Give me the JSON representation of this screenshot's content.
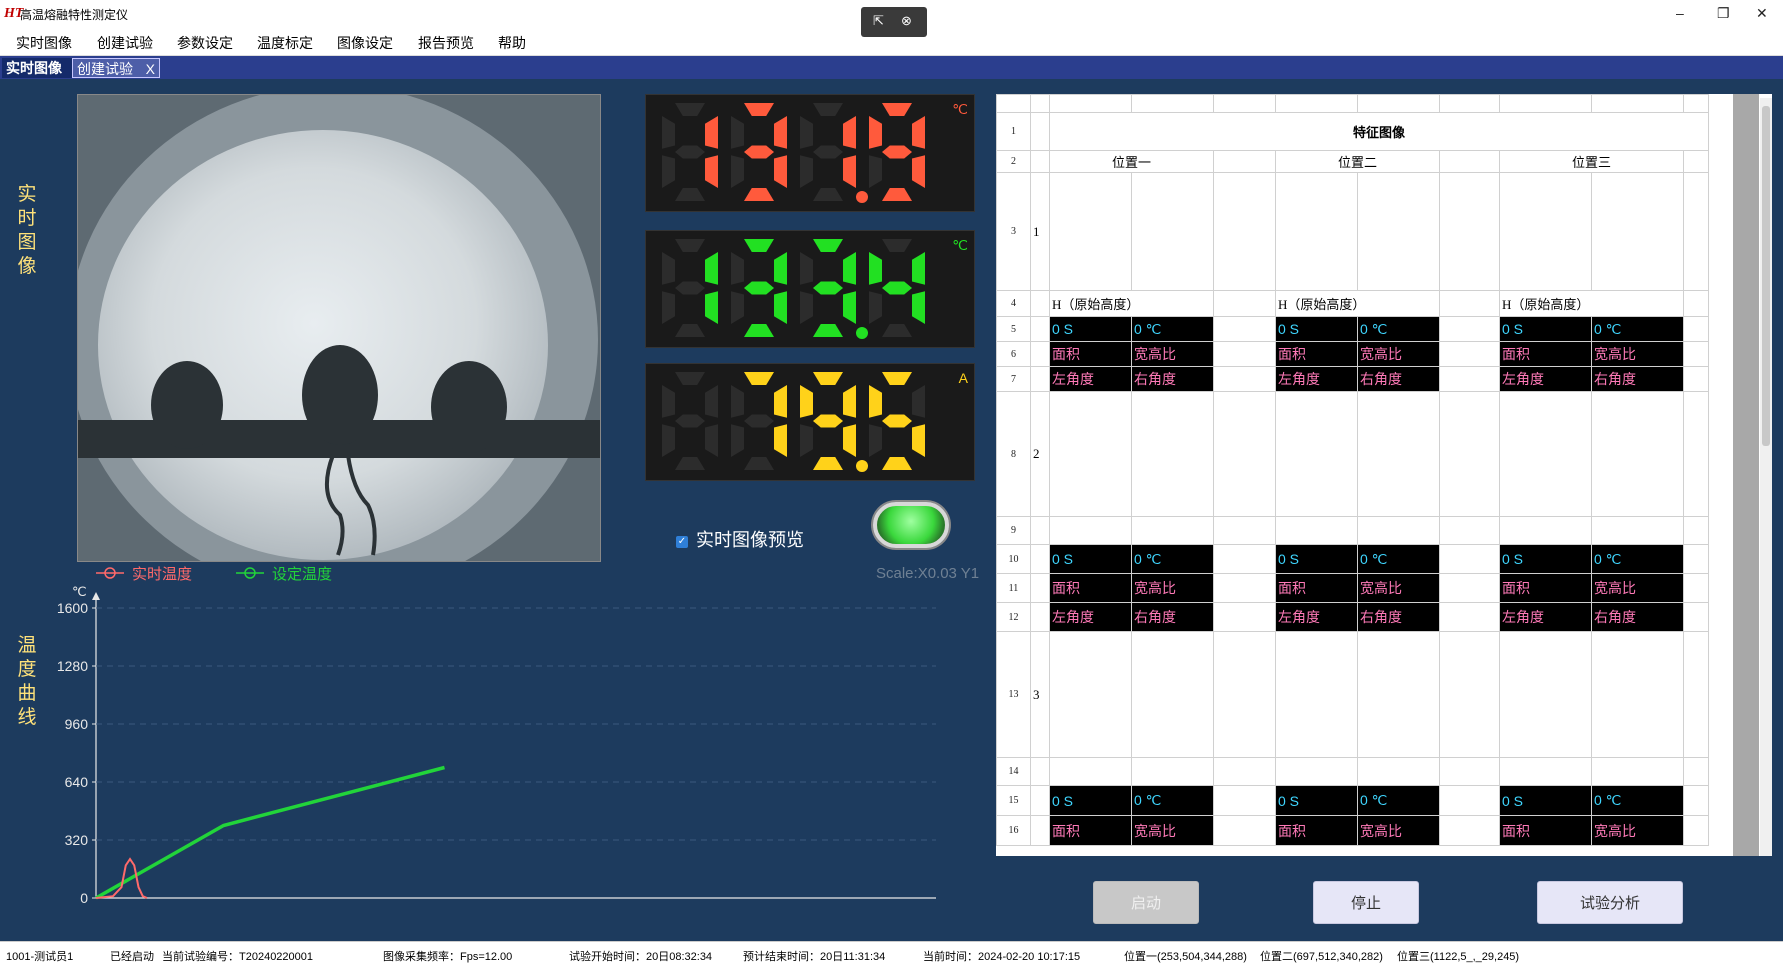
{
  "window": {
    "title": "高温熔融特性测定仪",
    "logo": "HT"
  },
  "menu": [
    "实时图像",
    "创建试验",
    "参数设定",
    "温度标定",
    "图像设定",
    "报告预览",
    "帮助"
  ],
  "tabs": [
    {
      "label": "实时图像"
    },
    {
      "label": "创建试验",
      "close": "X"
    }
  ],
  "left": {
    "image_label": "实时图像",
    "curve_label": "温度曲线"
  },
  "readouts": [
    {
      "value": "1319",
      "unit": "℃",
      "color": "#ff5a3c"
    },
    {
      "value": "1334",
      "unit": "℃",
      "color": "#22e022"
    },
    {
      "value": "795",
      "unit": "A",
      "color": "#ffd21a"
    }
  ],
  "preview_checkbox": {
    "label": "实时图像预览",
    "checked": true
  },
  "scale_text": "Scale:X0.03 Y1",
  "legend": {
    "real": "实时温度",
    "set": "设定温度"
  },
  "chart_data": {
    "type": "line",
    "yunit": "℃",
    "yticks": [
      0,
      320,
      640,
      960,
      1280,
      1600
    ],
    "ylim": [
      0,
      1600
    ],
    "xlim": [
      0,
      100
    ],
    "series": [
      {
        "name": "设定温度",
        "color": "#22d43a",
        "points": [
          [
            0,
            0
          ],
          [
            15,
            400
          ],
          [
            41,
            720
          ]
        ]
      },
      {
        "name": "实时温度",
        "color": "#ff6a6a",
        "points": [
          [
            0,
            0
          ],
          [
            2,
            10
          ],
          [
            3,
            60
          ],
          [
            3.5,
            180
          ],
          [
            4,
            215
          ],
          [
            4.5,
            180
          ],
          [
            5,
            60
          ],
          [
            5.5,
            10
          ],
          [
            6,
            0
          ]
        ]
      }
    ]
  },
  "sheet": {
    "title": "特征图像",
    "positions": [
      "位置一",
      "位置二",
      "位置三"
    ],
    "orig_height": "H（原始高度）",
    "row_labels": [
      "1",
      "2",
      "3"
    ],
    "time_val": "0 S",
    "temp_val": "0 ℃",
    "area": "面积",
    "ratio": "宽高比",
    "left_angle": "左角度",
    "right_angle": "右角度",
    "row_numbers": [
      "1",
      "2",
      "3",
      "4",
      "5",
      "6",
      "7",
      "8",
      "9",
      "10",
      "11",
      "12",
      "13",
      "14",
      "15",
      "16"
    ]
  },
  "buttons": {
    "start": "启动",
    "stop": "停止",
    "analyze": "试验分析"
  },
  "status": {
    "user": "1001-测试员1",
    "state": "已经启动",
    "test_no": "当前试验编号：T20240220001",
    "fps": "图像采集频率：Fps=12.00",
    "start_time": "试验开始时间：20日08:32:34",
    "end_time": "预计结束时间：20日11:31:34",
    "now": "当前时间：2024-02-20 10:17:15",
    "pos1": "位置一(253,504,344,288)",
    "pos2": "位置二(697,512,340,282)",
    "pos3": "位置三(1122,5_,_29,245)"
  },
  "icons": {
    "tool": "pointer-icon",
    "close": "close-circle-icon",
    "minimize": "minimize-icon",
    "restore": "restore-icon",
    "closewin": "close-icon"
  }
}
